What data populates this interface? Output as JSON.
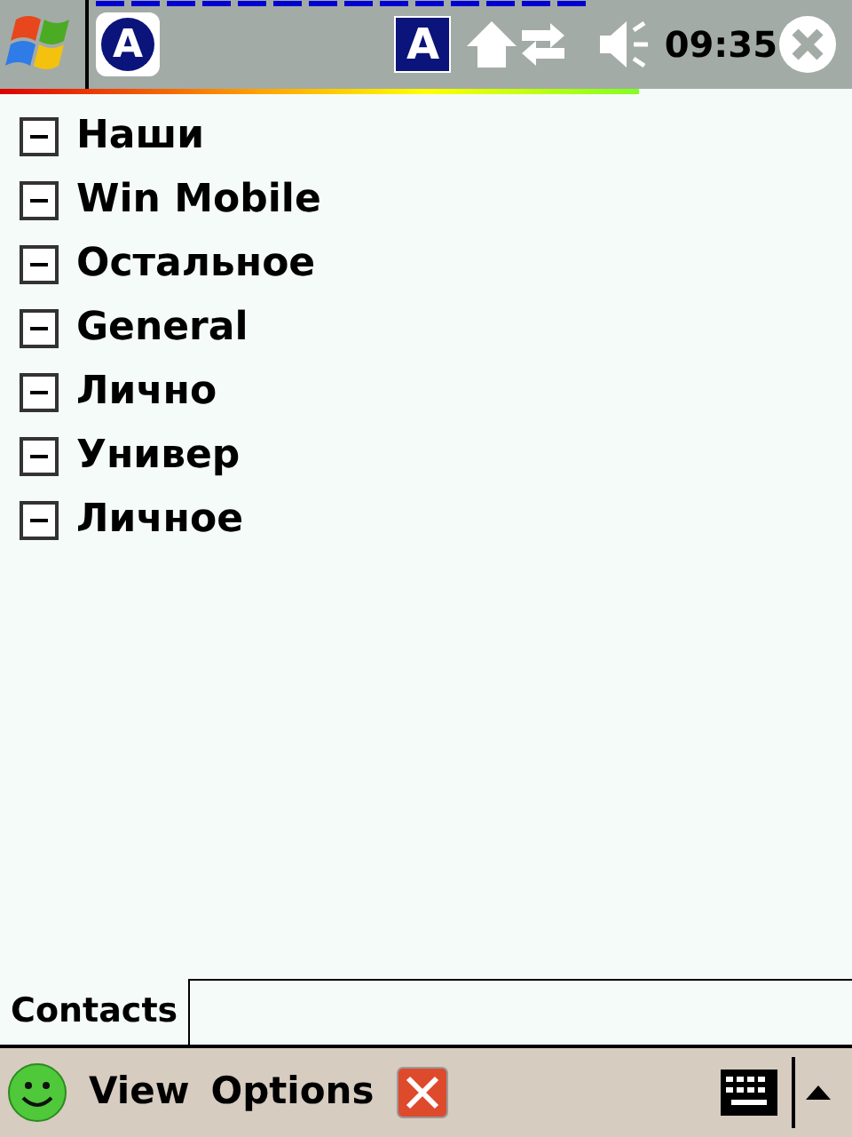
{
  "status_bar": {
    "app_badge": "A",
    "input_badge": "A",
    "time": "09:35"
  },
  "groups": [
    {
      "label": "Наши",
      "expanded": true
    },
    {
      "label": "Win Mobile",
      "expanded": true
    },
    {
      "label": "Остальное",
      "expanded": true
    },
    {
      "label": "General",
      "expanded": true
    },
    {
      "label": "Лично",
      "expanded": true
    },
    {
      "label": "Универ",
      "expanded": true
    },
    {
      "label": "Личное",
      "expanded": true
    }
  ],
  "tabs": [
    {
      "label": "Contacts",
      "selected": true
    }
  ],
  "menu_bar": {
    "left": "View",
    "right": "Options"
  }
}
